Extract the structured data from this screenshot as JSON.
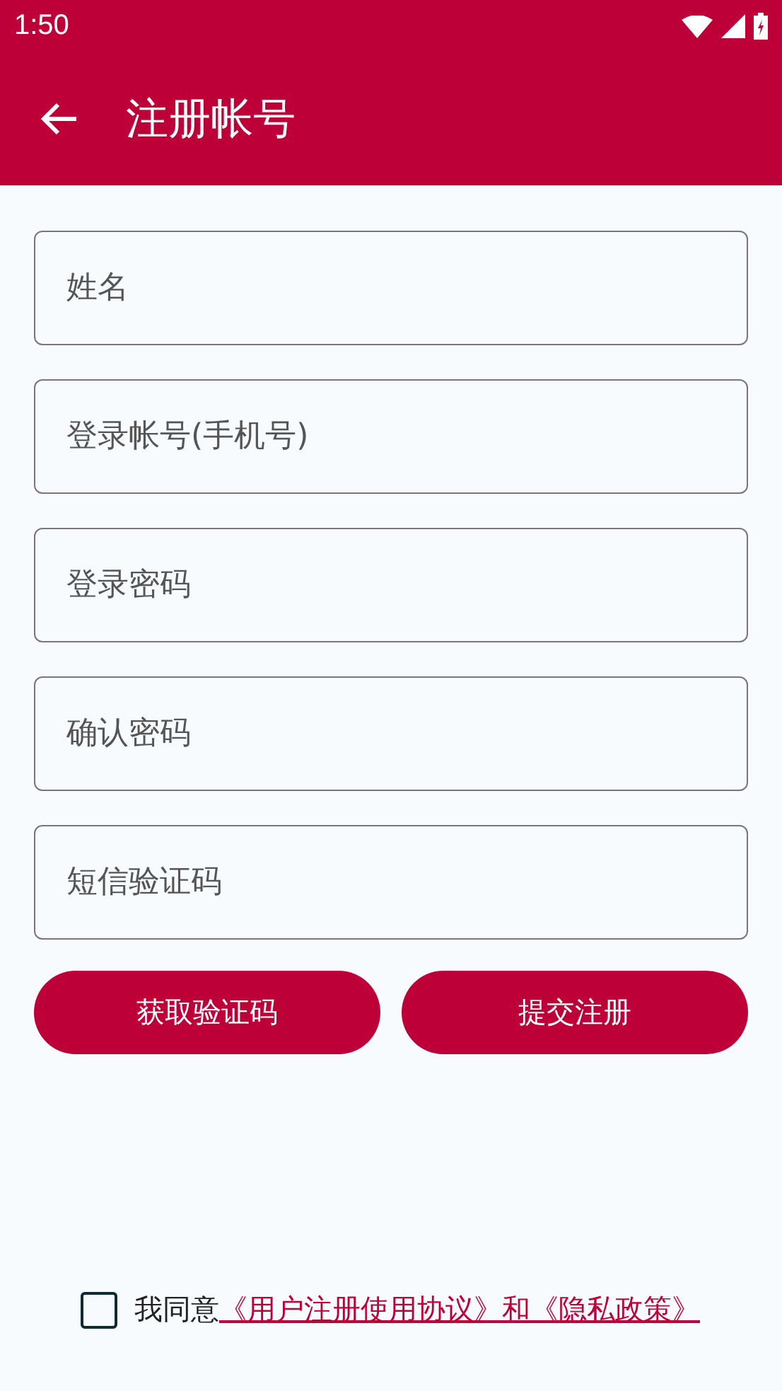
{
  "status_bar": {
    "time": "1:50"
  },
  "app_bar": {
    "title": "注册帐号"
  },
  "fields": [
    {
      "placeholder": "姓名"
    },
    {
      "placeholder": "登录帐号(手机号)"
    },
    {
      "placeholder": "登录密码"
    },
    {
      "placeholder": "确认密码"
    },
    {
      "placeholder": "短信验证码"
    }
  ],
  "buttons": [
    "获取验证码",
    "提交注册"
  ],
  "agreement": {
    "checked": false,
    "text": "我同意",
    "link": "《用户注册使用协议》和《隐私政策》"
  }
}
